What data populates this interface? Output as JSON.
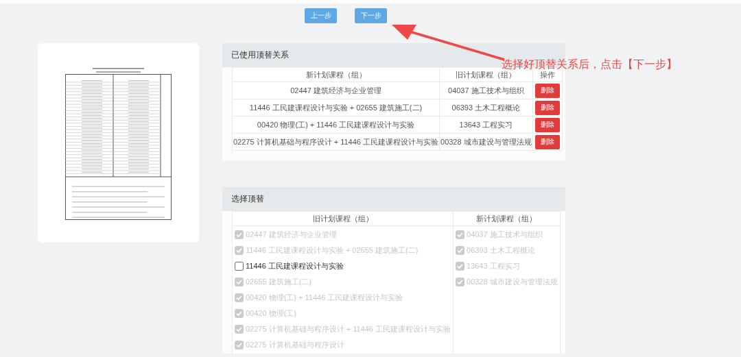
{
  "nav_buttons": [
    {
      "label": "上一步"
    },
    {
      "label": "下一步"
    }
  ],
  "annotation": {
    "text": "选择好顶替关系后，点击【下一步】"
  },
  "used_panel": {
    "title": "已使用顶替关系",
    "columns": [
      "新计划课程（组）",
      "旧计划课程（组）",
      "操作"
    ],
    "rows": [
      {
        "new": "02447 建筑经济与企业管理",
        "old": "04037 施工技术与组织",
        "action": "删除"
      },
      {
        "new": "11446 工民建课程设计与实验 + 02655 建筑施工(二)",
        "old": "06393 土木工程概论",
        "action": "删除"
      },
      {
        "new": "00420 物理(工) + 11446 工民建课程设计与实验",
        "old": "13643 工程实习",
        "action": "删除"
      },
      {
        "new": "02275 计算机基础与程序设计 + 11446 工民建课程设计与实验",
        "old": "00328 城市建设与管理法规",
        "action": "删除"
      }
    ]
  },
  "select_panel": {
    "title": "选择顶替",
    "columns": [
      "旧计划课程（组）",
      "新计划课程（组）"
    ],
    "old_items": [
      {
        "label": "02447 建筑经济与企业管理",
        "checked": true,
        "disabled": true
      },
      {
        "label": "11446 工民建课程设计与实验 + 02655 建筑施工(二)",
        "checked": true,
        "disabled": true
      },
      {
        "label": "11446 工民建课程设计与实验",
        "checked": false,
        "disabled": false
      },
      {
        "label": "02655 建筑施工(二)",
        "checked": true,
        "disabled": true
      },
      {
        "label": "00420 物理(工) + 11446 工民建课程设计与实验",
        "checked": true,
        "disabled": true
      },
      {
        "label": "00420 物理(工)",
        "checked": true,
        "disabled": true
      },
      {
        "label": "02275 计算机基础与程序设计 + 11446 工民建课程设计与实验",
        "checked": true,
        "disabled": true
      },
      {
        "label": "02275 计算机基础与程序设计",
        "checked": true,
        "disabled": true
      }
    ],
    "new_items": [
      {
        "label": "04037 施工技术与组织",
        "checked": true,
        "disabled": true
      },
      {
        "label": "06393 土木工程概论",
        "checked": true,
        "disabled": true
      },
      {
        "label": "13643 工程实习",
        "checked": true,
        "disabled": true
      },
      {
        "label": "00328 城市建设与管理法规",
        "checked": true,
        "disabled": true
      }
    ]
  }
}
